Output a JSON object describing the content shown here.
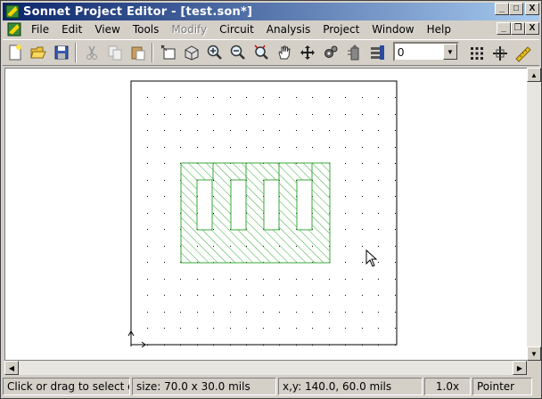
{
  "window": {
    "title": "Sonnet Project Editor - [test.son*]"
  },
  "titlebar_buttons": {
    "minimize": "_",
    "maximize": "□",
    "close": "X"
  },
  "doc_buttons": {
    "minimize": "_",
    "restore": "❐",
    "close": "X"
  },
  "menu": {
    "items": [
      {
        "label": "File",
        "enabled": true
      },
      {
        "label": "Edit",
        "enabled": true
      },
      {
        "label": "View",
        "enabled": true
      },
      {
        "label": "Tools",
        "enabled": true
      },
      {
        "label": "Modify",
        "enabled": false
      },
      {
        "label": "Circuit",
        "enabled": true
      },
      {
        "label": "Analysis",
        "enabled": true
      },
      {
        "label": "Project",
        "enabled": true
      },
      {
        "label": "Window",
        "enabled": true
      },
      {
        "label": "Help",
        "enabled": true
      }
    ]
  },
  "toolbar": {
    "level_value": "0",
    "icons": [
      "new-file-icon",
      "open-folder-icon",
      "save-icon",
      "cut-icon",
      "copy-icon",
      "paste-icon",
      "draw-rectangle-icon",
      "3d-view-icon",
      "zoom-in-icon",
      "zoom-out-icon",
      "zoom-fit-icon",
      "pan-hand-icon",
      "move-icon",
      "settings-gear-icon",
      "via-up-icon",
      "layer-stack-icon"
    ],
    "right_icons": [
      "grid-icon",
      "reference-plane-icon",
      "ruler-icon"
    ]
  },
  "status": {
    "hint": "Click or drag to select o",
    "size": "size: 70.0 x 30.0 mils",
    "coords": "x,y: 140.0, 60.0 mils",
    "zoom": "1.0x",
    "mode": "Pointer"
  },
  "colors": {
    "titlebar_start": "#0a246a",
    "titlebar_end": "#a6caf0",
    "metal": "#3aaa3a",
    "chrome": "#d4d0c8"
  }
}
